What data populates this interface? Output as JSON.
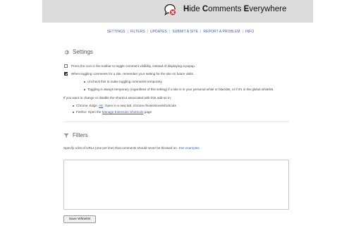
{
  "header": {
    "title_parts": [
      {
        "initial": "H",
        "rest": "ide "
      },
      {
        "initial": "C",
        "rest": "omments "
      },
      {
        "initial": "E",
        "rest": "verywhere"
      }
    ]
  },
  "nav": {
    "items": [
      "SETTINGS",
      "FILTERS",
      "UPDATES",
      "SUBMIT A SITE",
      "REPORT A PROBLEM",
      "INFO"
    ],
    "separator": "|"
  },
  "settings": {
    "heading": "Settings",
    "option1": {
      "label": "Press the icon in the toolbar to toggle comment visibility, instead of displaying a popup.",
      "checked": false
    },
    "option2": {
      "label": "When toggling comments for a site, remember your setting for the site on future visits.",
      "checked": true
    },
    "sub_notes": [
      "Uncheck this to make toggling comments temporary.",
      "Toggling is always temporary (regardless of this setting) if a site is in your personal white or blacklist, or if it's in the global whitelist."
    ],
    "shortcut_intro": "If you want to change or disable the shortcut associated with this add-on in:",
    "chrome": {
      "prefix": "Chrome, Edge, ",
      "etc_link": "etc",
      "suffix": ": Open in a new tab: chrome://extensions/shortcuts"
    },
    "firefox": {
      "prefix": "Firefox: Open the ",
      "link": "Manage Extension Shortcuts",
      "suffix": " page"
    }
  },
  "filters": {
    "heading": "Filters",
    "description_prefix": "Specify a list of URLs (one per line) that comments should never be blocked on. ",
    "examples_link": "See examples",
    "description_suffix": ".",
    "whitelist_value": "",
    "save_label": "Save Whitelist"
  },
  "colors": {
    "header_bg": "#dcdcdc",
    "link": "#3a5ea8",
    "logo_badge": "#e03030"
  }
}
